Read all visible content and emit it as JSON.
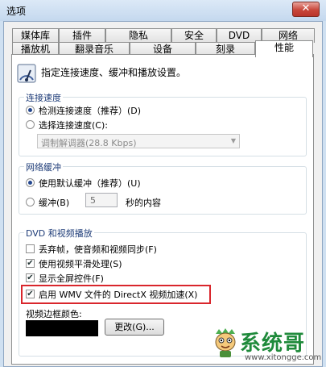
{
  "window": {
    "title": "选项",
    "close_glyph": "✕"
  },
  "tabs_row1": [
    "媒体库",
    "插件",
    "隐私",
    "安全",
    "DVD",
    "网络"
  ],
  "tabs_row2": [
    "播放机",
    "翻录音乐",
    "设备",
    "刻录",
    "性能"
  ],
  "active_tab": "性能",
  "header_text": "指定连接速度、缓冲和播放设置。",
  "connection": {
    "label": "连接速度",
    "detect": "检测连接速度（推荐）(D)",
    "choose": "选择连接速度(C):",
    "dropdown_value": "调制解调器(28.8 Kbps)"
  },
  "buffer": {
    "label": "网络缓冲",
    "default": "使用默认缓冲（推荐）(U)",
    "custom": "缓冲(B)",
    "seconds_value": "5",
    "suffix": "秒的内容"
  },
  "dvd": {
    "label": "DVD 和视频播放",
    "drop_frames": "丢弃帧，使音频和视频同步(F)",
    "smoothing": "使用视频平滑处理(S)",
    "fullscreen_controls": "显示全屏控件(F)",
    "directx": "启用 WMV 文件的 DirectX 视频加速(X)",
    "border_color_label": "视频边框颜色:",
    "change_button": "更改(G)..."
  },
  "watermark": {
    "text": "系统哥",
    "url": "www.xitongge.com"
  },
  "colors": {
    "highlight_box": "#d9262c",
    "border_swatch": "#000000",
    "group_label": "#1e3c78"
  }
}
